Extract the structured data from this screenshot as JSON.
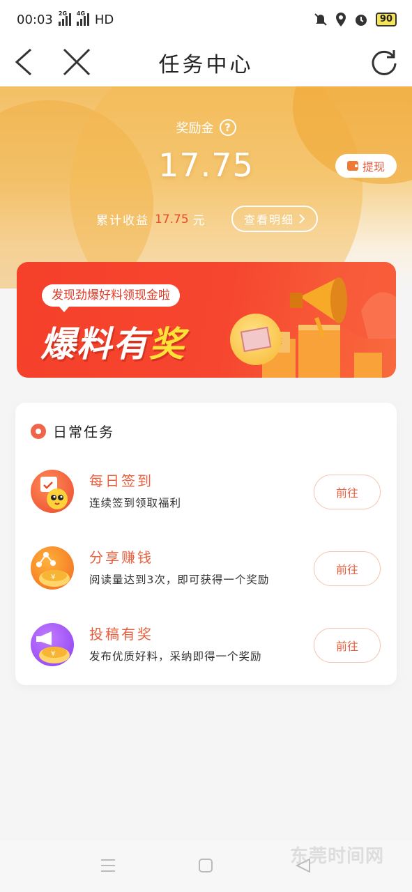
{
  "status": {
    "time": "00:03",
    "signal1": "2G",
    "signal2": "4G",
    "hd": "HD",
    "battery": "90"
  },
  "nav": {
    "title": "任务中心"
  },
  "header": {
    "reward_label": "奖励金",
    "reward_amount": "17.75",
    "withdraw_label": "提现",
    "total_label": "累计收益",
    "total_value": "17.75",
    "total_unit": "元",
    "detail_label": "查看明细"
  },
  "banner": {
    "tag": "发现劲爆好料领现金啦",
    "title_part1": "爆料有",
    "title_part2": "奖"
  },
  "tasks": {
    "section_title": "日常任务",
    "items": [
      {
        "title": "每日签到",
        "desc": "连续签到领取福利",
        "button": "前往"
      },
      {
        "title": "分享赚钱",
        "desc": "阅读量达到3次，即可获得一个奖励",
        "button": "前往"
      },
      {
        "title": "投稿有奖",
        "desc": "发布优质好料，采纳即得一个奖励",
        "button": "前往"
      }
    ]
  },
  "watermark": "东莞时间网"
}
